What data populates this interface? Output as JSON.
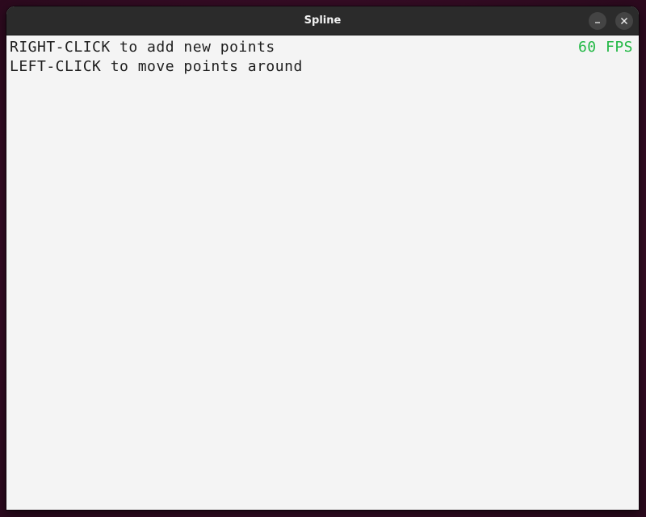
{
  "window": {
    "title": "Spline"
  },
  "canvas": {
    "instructions": [
      "RIGHT-CLICK to add new points",
      "LEFT-CLICK to move points around"
    ],
    "fps_text": "60 FPS",
    "fps_color": "#22b845",
    "text_color": "#1e1e1e",
    "background_color": "#f4f4f4"
  }
}
